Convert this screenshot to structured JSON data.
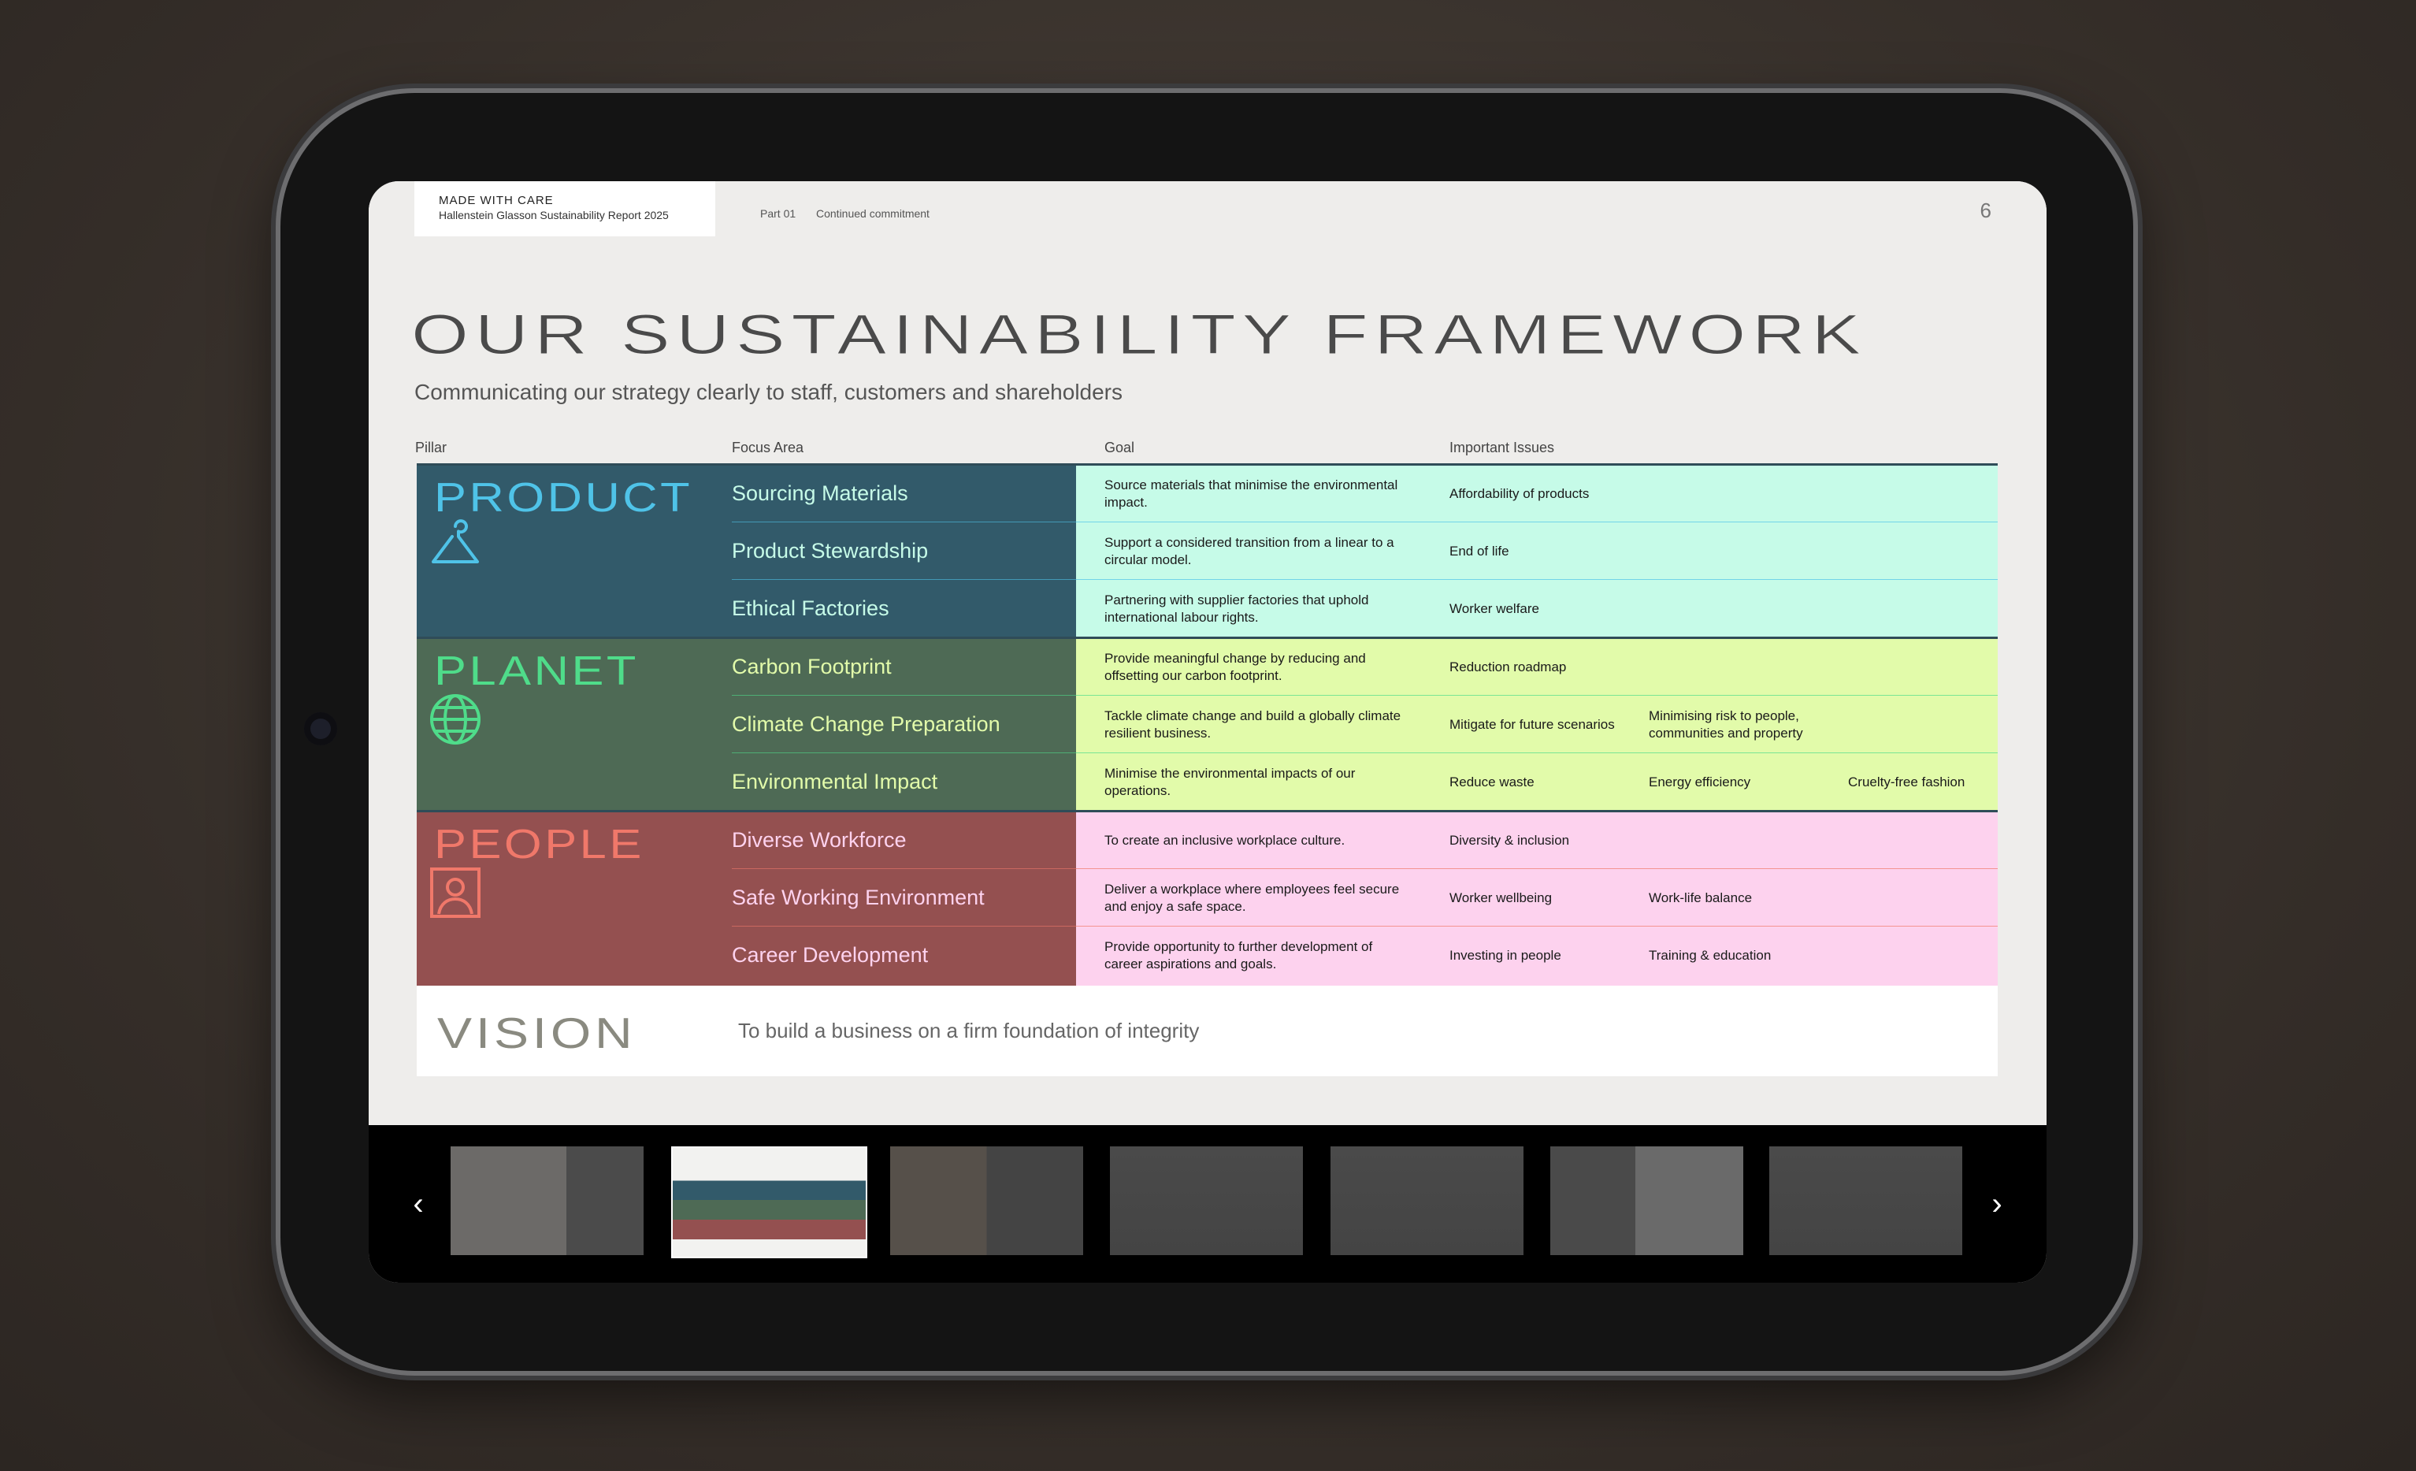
{
  "header": {
    "brand": "MADE WITH CARE",
    "report": "Hallenstein Glasson Sustainability Report 2025",
    "part": "Part 01",
    "section": "Continued commitment",
    "page_number": "6"
  },
  "title": "OUR SUSTAINABILITY FRAMEWORK",
  "subtitle": "Communicating our strategy clearly to staff, customers and shareholders",
  "columns": {
    "pillar": "Pillar",
    "focus": "Focus Area",
    "goal": "Goal",
    "issues": "Important Issues"
  },
  "pillars": [
    {
      "name": "PRODUCT",
      "icon": "hanger-icon",
      "color": "#4fc3e8",
      "bg": "#325a6a",
      "goal_bg": "#c6fbe8",
      "rows": [
        {
          "focus": "Sourcing Materials",
          "goal": "Source materials that minimise the environmental impact.",
          "issues": [
            "Affordability of products"
          ]
        },
        {
          "focus": "Product Stewardship",
          "goal": "Support a considered transition from a linear to a circular model.",
          "issues": [
            "End of life"
          ]
        },
        {
          "focus": "Ethical Factories",
          "goal": "Partnering with supplier factories that uphold international labour rights.",
          "issues": [
            "Worker welfare"
          ]
        }
      ]
    },
    {
      "name": "PLANET",
      "icon": "globe-icon",
      "color": "#4fdc8a",
      "bg": "#4e6a55",
      "goal_bg": "#e2fbaa",
      "rows": [
        {
          "focus": "Carbon Footprint",
          "goal": "Provide meaningful change by reducing and offsetting our carbon footprint.",
          "issues": [
            "Reduction roadmap"
          ]
        },
        {
          "focus": "Climate Change Preparation",
          "goal": "Tackle climate change and build a globally climate resilient business.",
          "issues": [
            "Mitigate for future scenarios",
            "Minimising risk to people, communities and property"
          ]
        },
        {
          "focus": "Environmental Impact",
          "goal": "Minimise the environmental impacts of our operations.",
          "issues": [
            "Reduce waste",
            "Energy efficiency",
            "Cruelty-free fashion"
          ]
        }
      ]
    },
    {
      "name": "PEOPLE",
      "icon": "person-icon",
      "color": "#f0786a",
      "bg": "#945050",
      "goal_bg": "#fdd2ee",
      "rows": [
        {
          "focus": "Diverse Workforce",
          "goal": "To create an inclusive workplace culture.",
          "issues": [
            "Diversity & inclusion"
          ]
        },
        {
          "focus": "Safe Working Environment",
          "goal": "Deliver a workplace where employees feel secure and enjoy a safe space.",
          "issues": [
            "Worker wellbeing",
            "Work-life balance"
          ]
        },
        {
          "focus": "Career Development",
          "goal": "Provide opportunity to further development of career aspirations and goals.",
          "issues": [
            "Investing in people",
            "Training & education"
          ]
        }
      ]
    }
  ],
  "vision": {
    "label": "VISION",
    "text": "To build a business on a firm foundation of integrity"
  },
  "thumbnails": [
    {
      "label": "page-thumbnail-brands"
    },
    {
      "label": "page-thumbnail-framework"
    },
    {
      "label": "page-thumbnail-standards"
    },
    {
      "label": "page-thumbnail-stakeholders"
    },
    {
      "label": "page-thumbnail-governance"
    },
    {
      "label": "page-thumbnail-materiality"
    },
    {
      "label": "page-thumbnail-financial"
    }
  ],
  "nav": {
    "prev_icon": "chevron-left-icon",
    "next_icon": "chevron-right-icon"
  }
}
